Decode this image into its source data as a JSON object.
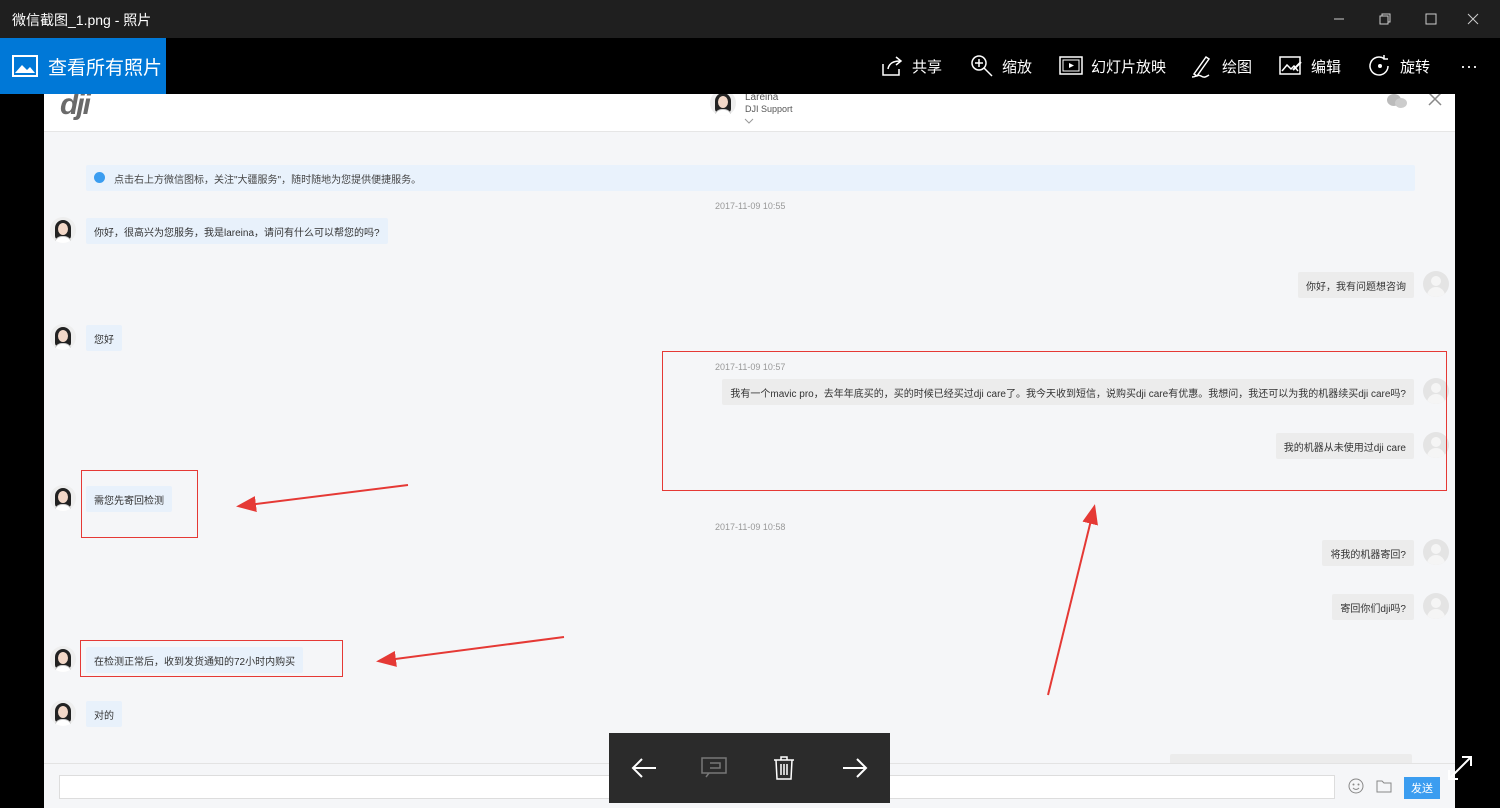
{
  "window": {
    "title": "微信截图_1.png - 照片"
  },
  "toolbar": {
    "all_photos": "查看所有照片",
    "share": "共享",
    "zoom": "缩放",
    "slideshow": "幻灯片放映",
    "draw": "绘图",
    "edit": "编辑",
    "rotate": "旋转",
    "more": "···"
  },
  "chat": {
    "logo": "dji",
    "agent_name": "Lareina",
    "agent_sub": "DJI Support",
    "notice": "点击右上方微信图标，关注\"大疆服务\"，随时随地为您提供便捷服务。",
    "timestamps": [
      "2017-11-09 10:55",
      "2017-11-09 10:57",
      "2017-11-09 10:58"
    ],
    "messages": [
      {
        "side": "left",
        "text": "你好，很高兴为您服务，我是lareina，请问有什么可以帮您的吗?"
      },
      {
        "side": "right",
        "text": "你好，我有问题想咨询"
      },
      {
        "side": "left",
        "text": "您好"
      },
      {
        "side": "right",
        "text": "我有一个mavic pro，去年年底买的，买的时候已经买过dji care了。我今天收到短信，说购买dji care有优惠。我想问，我还可以为我的机器续买dji care吗?"
      },
      {
        "side": "right",
        "text": "我的机器从未使用过dji care"
      },
      {
        "side": "left",
        "text": "需您先寄回检测"
      },
      {
        "side": "right",
        "text": "将我的机器寄回?"
      },
      {
        "side": "right",
        "text": "寄回你们dji吗?"
      },
      {
        "side": "left",
        "text": "在检测正常后，收到发货通知的72小时内购买"
      },
      {
        "side": "left",
        "text": "对的"
      }
    ],
    "send": "发送"
  },
  "colors": {
    "accent": "#0078d7",
    "annotation": "#e53935",
    "send": "#3b9df0"
  }
}
